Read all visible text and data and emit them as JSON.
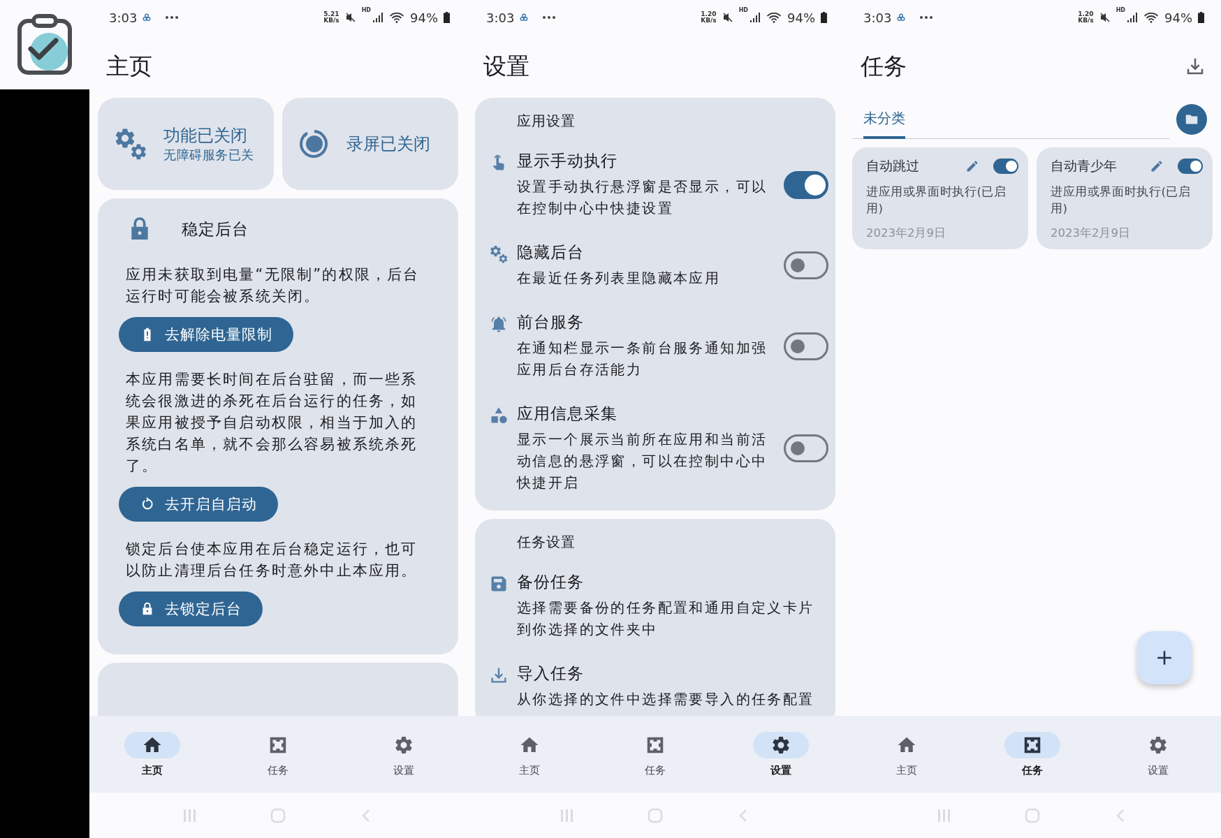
{
  "screens": [
    {
      "kind": "home",
      "status_bar": {
        "time": "3:03",
        "speed": "5.21",
        "speed_unit": "KB/s",
        "network": "HD",
        "battery": "94%"
      },
      "title": "主页",
      "status_cards": [
        {
          "kind": "gears",
          "title": "功能已关闭",
          "subtitle": "无障碍服务已关"
        },
        {
          "kind": "record",
          "title": "录屏已关闭"
        }
      ],
      "background_card": {
        "kind": "lock",
        "title": "稳定后台",
        "sections": [
          {
            "text": "应用未获取到电量“无限制”的权限，后台运行时可能会被系统关闭。",
            "button": {
              "kind": "battery",
              "label": "去解除电量限制"
            }
          },
          {
            "text": "本应用需要长时间在后台驻留，而一些系统会很激进的杀死在后台运行的任务，如果应用被授予自启动权限，相当于加入的系统白名单，就不会那么容易被系统杀死了。",
            "button": {
              "kind": "refresh",
              "label": "去开启自启动"
            }
          },
          {
            "text": "锁定后台使本应用在后台稳定运行，也可以防止清理后台任务时意外中止本应用。",
            "button": {
              "kind": "lock",
              "label": "去锁定后台"
            }
          }
        ]
      },
      "nav": [
        {
          "kind": "home",
          "label": "主页",
          "selected": true
        },
        {
          "kind": "tasks",
          "label": "任务",
          "selected": false
        },
        {
          "kind": "gear",
          "label": "设置",
          "selected": false
        }
      ]
    },
    {
      "kind": "settings",
      "status_bar": {
        "time": "3:03",
        "speed": "1.20",
        "speed_unit": "KB/s",
        "network": "HD",
        "battery": "94%"
      },
      "title": "设置",
      "sections": [
        {
          "title": "应用设置",
          "items": [
            {
              "kind": "touch",
              "title": "显示手动执行",
              "description": "设置手动执行悬浮窗是否显示，可以在控制中心中快捷设置",
              "on": true
            },
            {
              "kind": "gears",
              "title": "隐藏后台",
              "description": "在最近任务列表里隐藏本应用",
              "on": false
            },
            {
              "kind": "bell",
              "title": "前台服务",
              "description": "在通知栏显示一条前台服务通知加强应用后台存活能力",
              "on": false
            },
            {
              "kind": "shapes",
              "title": "应用信息采集",
              "description": "显示一个展示当前所在应用和当前活动信息的悬浮窗，可以在控制中心中快捷开启",
              "on": false
            }
          ]
        },
        {
          "title": "任务设置",
          "items": [
            {
              "kind": "save",
              "title": "备份任务",
              "description": "选择需要备份的任务配置和通用自定义卡片到你选择的文件夹中"
            },
            {
              "kind": "download",
              "title": "导入任务",
              "description": "从你选择的文件中选择需要导入的任务配置"
            }
          ]
        }
      ],
      "nav": [
        {
          "kind": "home",
          "label": "主页",
          "selected": false
        },
        {
          "kind": "tasks",
          "label": "任务",
          "selected": false
        },
        {
          "kind": "gear",
          "label": "设置",
          "selected": true
        }
      ]
    },
    {
      "kind": "tasks",
      "status_bar": {
        "time": "3:03",
        "speed": "1.20",
        "speed_unit": "KB/s",
        "network": "HD",
        "battery": "94%"
      },
      "title": "任务",
      "tabs": [
        {
          "label": "未分类",
          "selected": true
        }
      ],
      "tasks": [
        {
          "title": "自动跳过",
          "on": true,
          "description": "进应用或界面时执行(已启用)",
          "date": "2023年2月9日"
        },
        {
          "title": "自动青少年",
          "on": true,
          "description": "进应用或界面时执行(已启用)",
          "date": "2023年2月9日"
        }
      ],
      "nav": [
        {
          "kind": "home",
          "label": "主页",
          "selected": false
        },
        {
          "kind": "tasks",
          "label": "任务",
          "selected": true
        },
        {
          "kind": "gear",
          "label": "设置",
          "selected": false
        }
      ]
    }
  ]
}
